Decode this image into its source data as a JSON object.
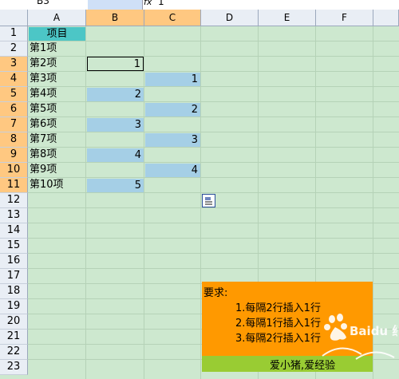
{
  "namebox": "B3",
  "formula_value": "1",
  "fx_label": "fx",
  "columns": [
    "A",
    "B",
    "C",
    "D",
    "E",
    "F"
  ],
  "rows": [
    "1",
    "2",
    "3",
    "4",
    "5",
    "6",
    "7",
    "8",
    "9",
    "10",
    "11",
    "12",
    "13",
    "14",
    "15",
    "16",
    "17",
    "18",
    "19",
    "20",
    "21",
    "22",
    "23"
  ],
  "header_cell": "项目",
  "items": [
    "第1项",
    "第2项",
    "第3项",
    "第4项",
    "第5项",
    "第6项",
    "第7项",
    "第8项",
    "第9项",
    "第10项"
  ],
  "b_values": [
    "1",
    "2",
    "3",
    "4",
    "5"
  ],
  "c_values": [
    "1",
    "2",
    "3",
    "4"
  ],
  "note": {
    "title": "要求:",
    "lines": [
      "1.每隔2行插入1行",
      "2.每隔1行插入1行",
      "3.每隔2行插入1行"
    ],
    "footer": "爱小猪,爱经验"
  },
  "watermark_text": "Baidu 经验",
  "colors": {
    "grid_bg": "#CDE8CF",
    "header_cell": "#4CC6C6",
    "value_fill": "#A5CFE6",
    "note_bg": "#FF9900",
    "note_footer": "#99CC33",
    "selected_header": "#FFC881"
  }
}
